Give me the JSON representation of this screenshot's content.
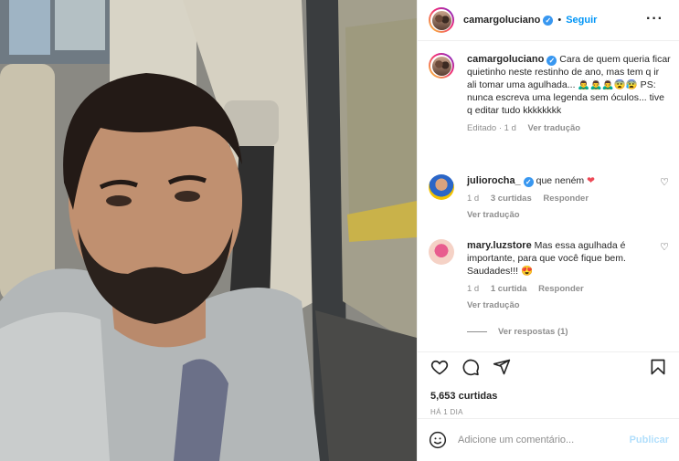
{
  "post": {
    "author": "camargoluciano",
    "follow_label": "Seguir",
    "separator": "•",
    "more_icon": "more-horizontal-icon"
  },
  "caption": {
    "author": "camargoluciano",
    "text": "Cara de quem queria ficar quietinho neste restinho de ano, mas tem q ir ali tomar uma agulhada... 🙇‍♂️🙇‍♂️🙇‍♂️😨😰 PS: nunca escreva uma legenda sem óculos... tive q editar tudo kkkkkkkk",
    "meta": "Editado · 1 d",
    "see_translation": "Ver tradução"
  },
  "comments": [
    {
      "author": "juliorocha_",
      "text": "que neném",
      "emoji": "❤",
      "age": "1 d",
      "likes": "3 curtidas",
      "reply": "Responder",
      "see_translation": "Ver tradução"
    },
    {
      "author": "mary.luzstore",
      "text": "Mas essa agulhada é importante, para que você fique bem. Saudades!!!",
      "emoji": "😍",
      "age": "1 d",
      "likes": "1 curtida",
      "reply": "Responder",
      "see_translation": "Ver tradução",
      "view_replies": "Ver respostas (1)"
    }
  ],
  "actions": {
    "like_icon": "heart-icon",
    "comment_icon": "comment-icon",
    "share_icon": "send-icon",
    "save_icon": "bookmark-icon"
  },
  "likes_count": "5,653 curtidas",
  "timestamp": "HÁ 1 DIA",
  "add_comment": {
    "placeholder": "Adicione um comentário...",
    "publish_label": "Publicar",
    "emoji_icon": "smiley-icon"
  },
  "colors": {
    "link_blue": "#0095f6",
    "publish_disabled": "#b2dffc",
    "muted": "#8e8e8e",
    "verified_blue": "#3897f0"
  }
}
